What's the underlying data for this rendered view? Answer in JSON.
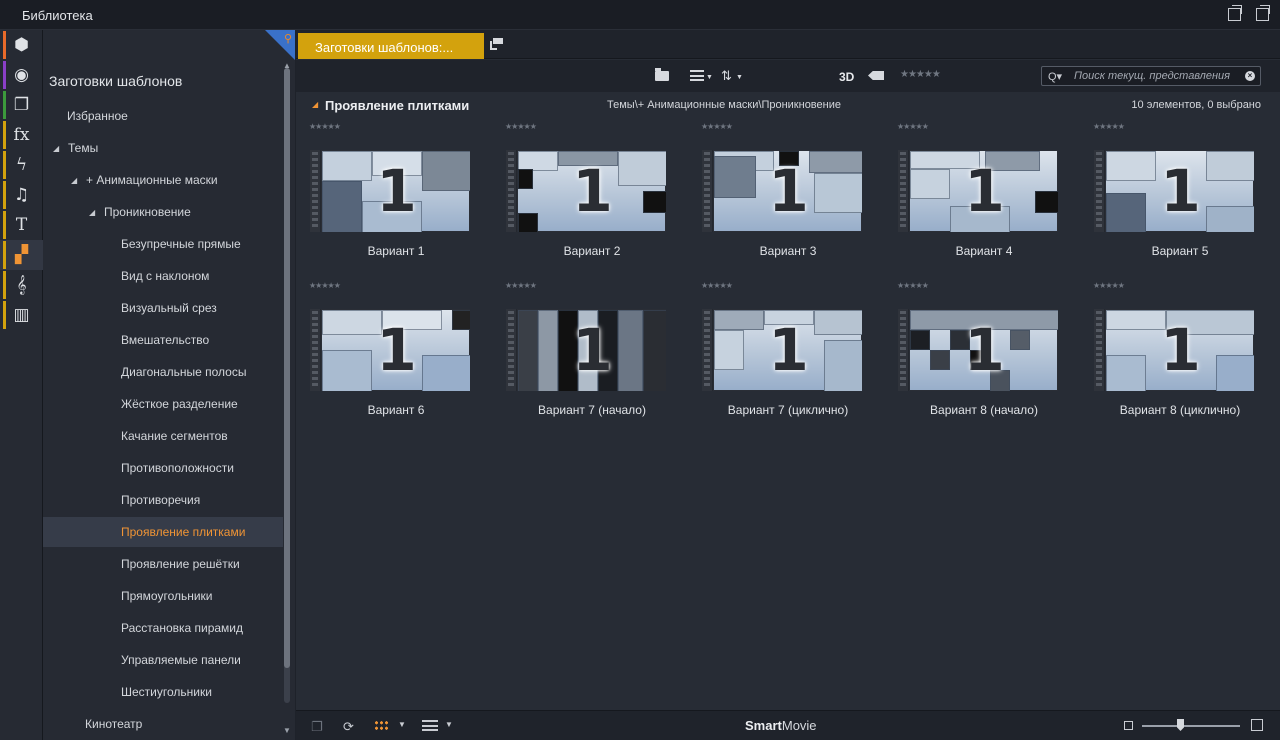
{
  "window": {
    "title": "Библиотека"
  },
  "rail": {
    "items": [
      {
        "icon": "box-icon",
        "glyph": "⬢",
        "color": "#e86a2a"
      },
      {
        "icon": "film-reel-icon",
        "glyph": "◉",
        "color": "#8a3fc7"
      },
      {
        "icon": "stack-icon",
        "glyph": "❐",
        "color": "#3c9a3c"
      },
      {
        "icon": "fx-icon",
        "glyph": "fx",
        "color": "#d3a20d"
      },
      {
        "icon": "lightning-icon",
        "glyph": "ϟ",
        "color": "#d3a20d"
      },
      {
        "icon": "music-note-icon",
        "glyph": "♫",
        "color": "#d3a20d"
      },
      {
        "icon": "text-icon",
        "glyph": "T",
        "color": "#d3a20d"
      },
      {
        "icon": "template-icon",
        "glyph": "▞",
        "color": "#d3a20d",
        "active": true
      },
      {
        "icon": "treble-clef-icon",
        "glyph": "𝄞",
        "color": "#d3a20d"
      },
      {
        "icon": "piano-icon",
        "glyph": "▥",
        "color": "#d3a20d"
      }
    ]
  },
  "tree": {
    "heading": "Заготовки шаблонов",
    "items": [
      {
        "label": "Избранное",
        "indent": 24,
        "tri": ""
      },
      {
        "label": "Темы",
        "indent": 10,
        "tri": "◢"
      },
      {
        "label": "+ Анимационные маски",
        "indent": 28,
        "tri": "◢"
      },
      {
        "label": "Проникновение",
        "indent": 46,
        "tri": "◢"
      },
      {
        "label": "Безупречные прямые",
        "indent": 78,
        "tri": ""
      },
      {
        "label": "Вид с наклоном",
        "indent": 78,
        "tri": ""
      },
      {
        "label": "Визуальный срез",
        "indent": 78,
        "tri": ""
      },
      {
        "label": "Вмешательство",
        "indent": 78,
        "tri": ""
      },
      {
        "label": "Диагональные полосы",
        "indent": 78,
        "tri": ""
      },
      {
        "label": "Жёсткое разделение",
        "indent": 78,
        "tri": ""
      },
      {
        "label": "Качание сегментов",
        "indent": 78,
        "tri": ""
      },
      {
        "label": "Противоположности",
        "indent": 78,
        "tri": ""
      },
      {
        "label": "Противоречия",
        "indent": 78,
        "tri": ""
      },
      {
        "label": "Проявление плитками",
        "indent": 78,
        "tri": "",
        "selected": true
      },
      {
        "label": "Проявление решётки",
        "indent": 78,
        "tri": ""
      },
      {
        "label": "Прямоугольники",
        "indent": 78,
        "tri": ""
      },
      {
        "label": "Расстановка пирамид",
        "indent": 78,
        "tri": ""
      },
      {
        "label": "Управляемые панели",
        "indent": 78,
        "tri": ""
      },
      {
        "label": "Шестиугольники",
        "indent": 78,
        "tri": ""
      },
      {
        "label": "Кинотеатр",
        "indent": 42,
        "tri": ""
      }
    ]
  },
  "tab": {
    "label": "Заготовки шаблонов:..."
  },
  "toolbar": {
    "view3d": "3D",
    "stars": "★★★★★",
    "search_placeholder": "Поиск текущ. представления",
    "search_icon": "Q▾",
    "clear_glyph": "×"
  },
  "section": {
    "title": "Проявление плитками",
    "path": "Темы\\+ Анимационные маски\\Проникновение",
    "count": "10 элементов, 0 выбрано"
  },
  "items": [
    {
      "label": "Вариант 1",
      "stars": "★★★★★"
    },
    {
      "label": "Вариант 2",
      "stars": "★★★★★"
    },
    {
      "label": "Вариант 3",
      "stars": "★★★★★"
    },
    {
      "label": "Вариант 4",
      "stars": "★★★★★"
    },
    {
      "label": "Вариант 5",
      "stars": "★★★★★"
    },
    {
      "label": "Вариант 6",
      "stars": "★★★★★"
    },
    {
      "label": "Вариант 7 (начало)",
      "stars": "★★★★★"
    },
    {
      "label": "Вариант 7 (циклично)",
      "stars": "★★★★★"
    },
    {
      "label": "Вариант 8 (начало)",
      "stars": "★★★★★"
    },
    {
      "label": "Вариант 8 (циклично)",
      "stars": "★★★★★"
    }
  ],
  "thumb_digit": "1",
  "bottombar": {
    "brand_bold": "Smart",
    "brand_rest": "Movie"
  },
  "colors": {
    "accent": "#f09435",
    "tab": "#d3a20d"
  }
}
